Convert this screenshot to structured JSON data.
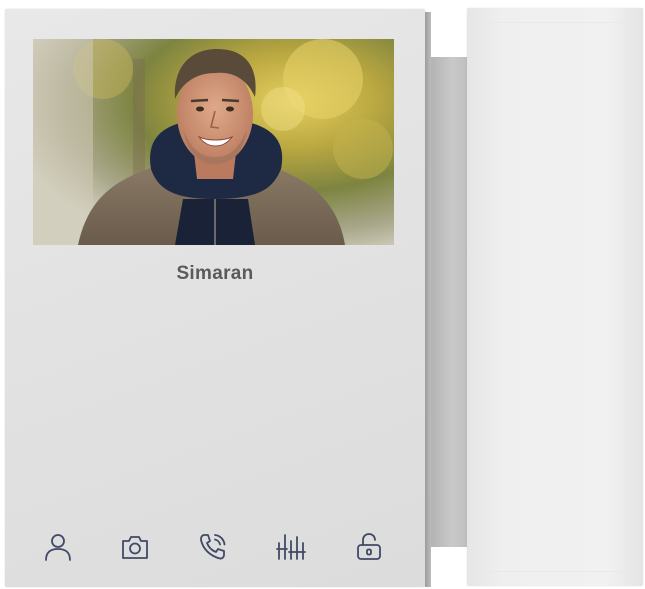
{
  "device": {
    "caller_name": "Simaran"
  },
  "icons": {
    "contacts": "person-icon",
    "snapshot": "camera-icon",
    "call": "phone-call-icon",
    "settings": "equalizer-icon",
    "unlock": "unlock-icon"
  },
  "colors": {
    "panel": "#e1e1e1",
    "icon_stroke": "#404a66",
    "name_text": "#5a5a5a"
  }
}
